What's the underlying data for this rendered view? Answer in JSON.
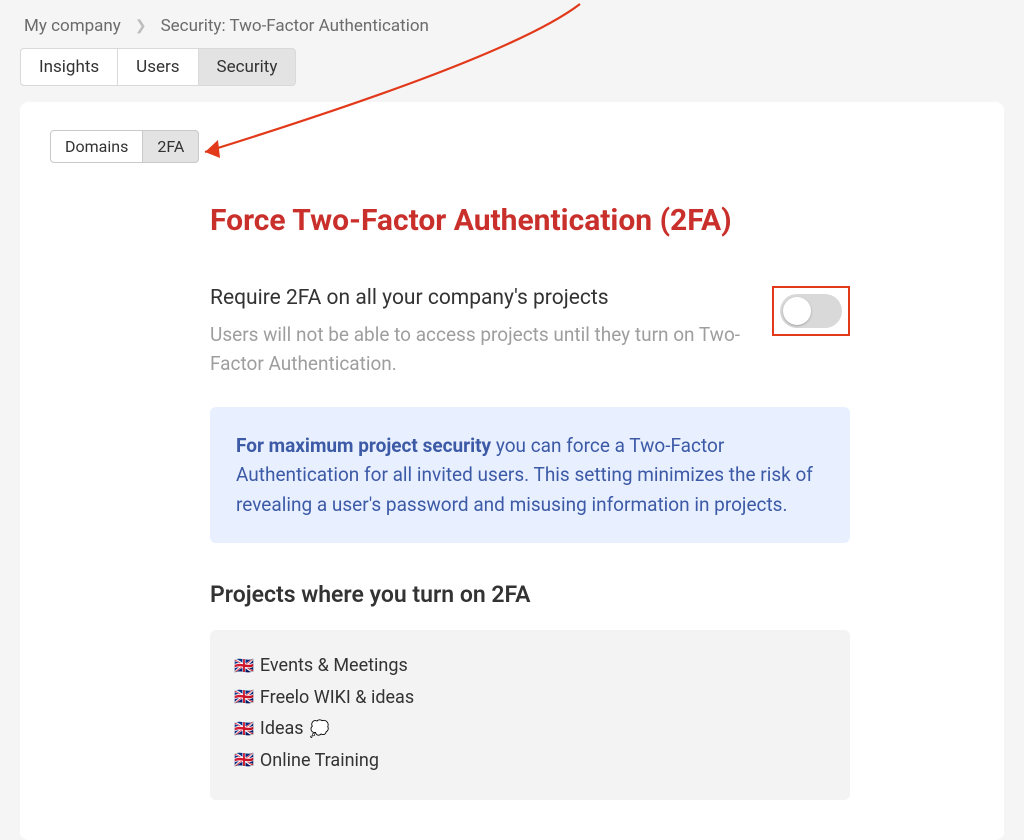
{
  "breadcrumb": {
    "root": "My company",
    "current": "Security: Two-Factor Authentication"
  },
  "mainTabs": {
    "insights": "Insights",
    "users": "Users",
    "security": "Security"
  },
  "subTabs": {
    "domains": "Domains",
    "twofa": "2FA"
  },
  "heading": "Force Two-Factor Authentication (2FA)",
  "setting": {
    "label": "Require 2FA on all your company's projects",
    "desc": "Users will not be able to access projects until they turn on Two-Factor Authentication.",
    "toggle": false
  },
  "info": {
    "strong": "For maximum project security",
    "rest": " you can force a Two-Factor Authentication for all invited users. This setting minimizes the risk of revealing a user's password and misusing information in projects."
  },
  "projectsHeading": "Projects where you turn on 2FA",
  "projects": [
    {
      "flag": "🇬🇧",
      "name": "Events & Meetings",
      "extra": ""
    },
    {
      "flag": "🇬🇧",
      "name": "Freelo WIKI & ideas",
      "extra": ""
    },
    {
      "flag": "🇬🇧",
      "name": "Ideas",
      "extra": "💭"
    },
    {
      "flag": "🇬🇧",
      "name": "Online Training",
      "extra": ""
    }
  ],
  "colors": {
    "accent": "#c9302c",
    "annotation": "#e2391b",
    "infoBg": "#e8efff",
    "infoText": "#3c5aa6"
  }
}
